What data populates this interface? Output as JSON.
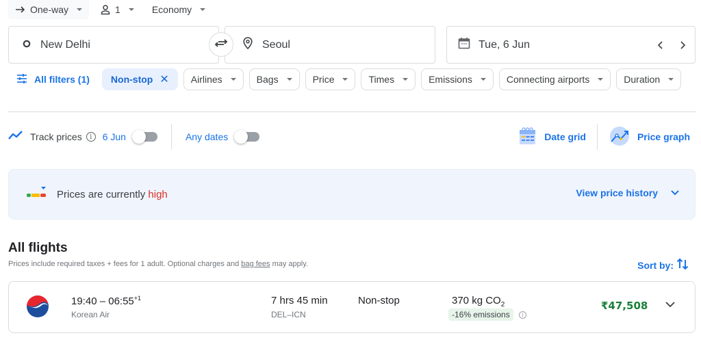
{
  "trip_bar": {
    "trip_type": "One-way",
    "passengers": "1",
    "cabin_class": "Economy"
  },
  "search": {
    "origin": "New Delhi",
    "destination": "Seoul",
    "date": "Tue, 6 Jun"
  },
  "filters": {
    "all_filters": "All filters (1)",
    "active_chip": "Non-stop",
    "chips": [
      "Airlines",
      "Bags",
      "Price",
      "Times",
      "Emissions",
      "Connecting airports",
      "Duration"
    ]
  },
  "tracking": {
    "track_label": "Track prices",
    "track_date": "6 Jun",
    "track_date_enabled": false,
    "any_dates_label": "Any dates",
    "any_dates_enabled": false,
    "date_grid_label": "Date grid",
    "price_graph_label": "Price graph"
  },
  "insight": {
    "text_prefix": "Prices are currently",
    "level": "high",
    "link": "View price history"
  },
  "results": {
    "title": "All flights",
    "subtitle_prefix": "Prices include required taxes + fees for 1 adult. Optional charges and",
    "subtitle_link": "bag fees",
    "subtitle_suffix": "may apply.",
    "sort_label": "Sort by:",
    "flights": [
      {
        "depart": "19:40",
        "arrive": "06:55",
        "day_offset": "+1",
        "airline": "Korean Air",
        "duration": "7 hrs 45 min",
        "route": "DEL–ICN",
        "stops": "Non-stop",
        "emissions_value": "370 kg CO",
        "emissions_sub": "2",
        "emissions_delta": "-16% emissions",
        "price": "₹47,508"
      }
    ]
  },
  "colors": {
    "accent": "#1a73e8",
    "price_green": "#188038",
    "high_red": "#d93025",
    "insight_bg": "#f0f4fc",
    "emissions_badge_bg": "#e6f4ea"
  }
}
